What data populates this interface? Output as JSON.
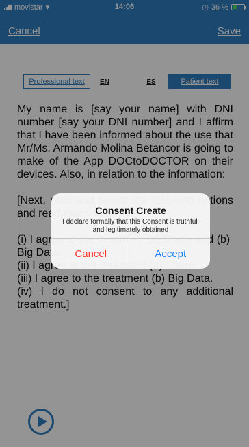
{
  "status_bar": {
    "carrier": "movistar",
    "time": "14:06",
    "battery": "36 %",
    "battery_level": 0.36
  },
  "nav": {
    "cancel_label": "Cancel",
    "save_label": "Save"
  },
  "language_bar": {
    "professional_tab": "Professional text",
    "lang_en": "EN",
    "lang_es": "ES",
    "patient_tab": "Patient text"
  },
  "consent_text": {
    "paragraph_1": "My name is [say your name] with DNI number [say your DNI number] and I affirm that I have been informed about the use that Mr/Ms. Armando Molina Betancor is going to make of the App DOCtoDOCTOR on their devices. Also, in relation to the information:",
    "paragraph_2": "[Next, read and select the following options and read them aloud]",
    "item_1": "(i) I agree to the treatment (a) Share and (b) Big Data.",
    "item_2": "(ii) I agree to the treatment (a) Share.",
    "item_3": "(iii) I agree to the treatment (b) Big Data.",
    "item_4": "(iv) I do not consent to any additional treatment.]"
  },
  "alert": {
    "title": "Consent Create",
    "message": "I declare formally that this Consent is truthfull and legitimately obtained",
    "cancel_label": "Cancel",
    "accept_label": "Accept"
  },
  "colors": {
    "brand_blue": "#2f7dbf",
    "destructive_red": "#ff3b30",
    "action_blue": "#1a82f7"
  },
  "icons": {
    "play": "play-icon"
  }
}
